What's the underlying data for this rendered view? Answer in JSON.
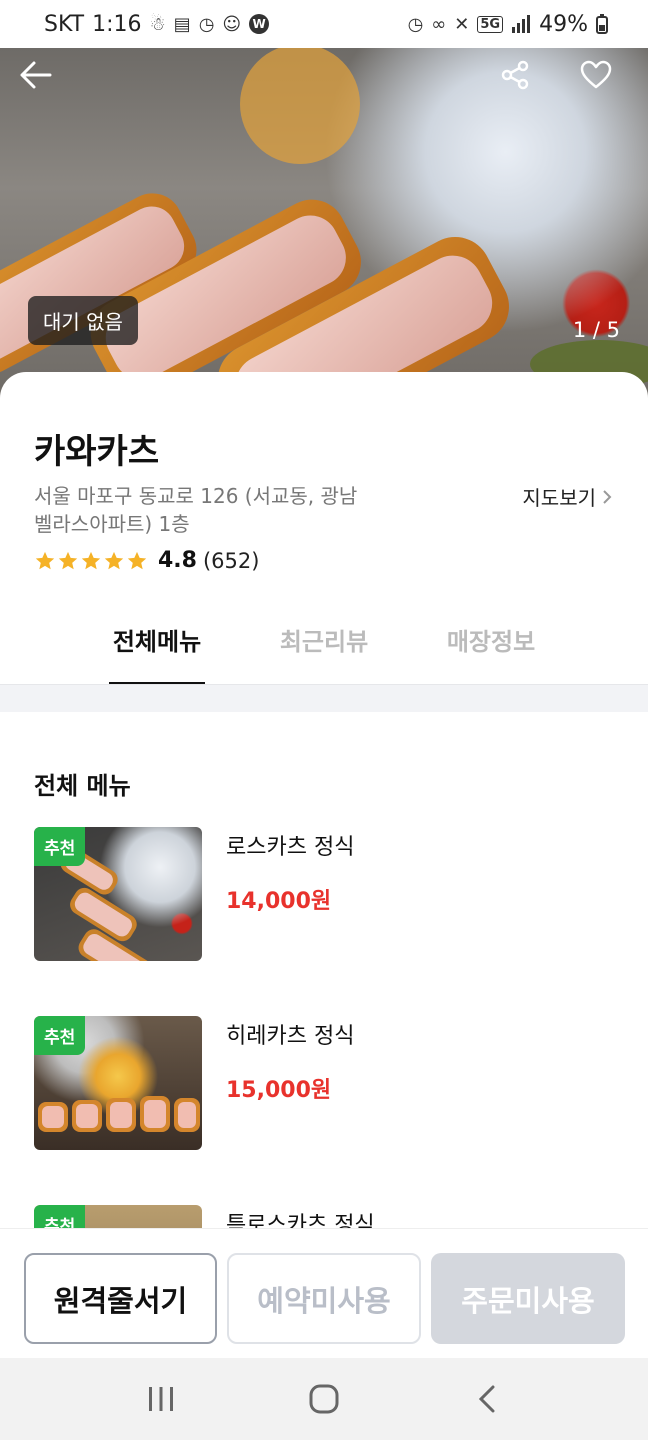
{
  "status": {
    "carrier": "SKT",
    "time": "1:16",
    "network": "5G",
    "battery": "49%",
    "w_badge": "W"
  },
  "hero": {
    "waiting_badge": "대기 없음",
    "image_counter": "1 / 5"
  },
  "store": {
    "name": "카와카츠",
    "address": "서울 마포구 동교로 126 (서교동, 광남벨라스아파트) 1층",
    "map_link": "지도보기",
    "rating": "4.8",
    "review_count": "(652)",
    "rating_stars": 5
  },
  "tabs": [
    {
      "label": "전체메뉴",
      "active": true
    },
    {
      "label": "최근리뷰",
      "active": false
    },
    {
      "label": "매장정보",
      "active": false
    }
  ],
  "menu": {
    "section_title": "전체 메뉴",
    "items": [
      {
        "badge": "추천",
        "name": "로스카츠 정식",
        "price": "14,000원"
      },
      {
        "badge": "추천",
        "name": "히레카츠 정식",
        "price": "15,000원"
      },
      {
        "badge": "추천",
        "name": "특로스카츠 정식",
        "price": ""
      }
    ]
  },
  "actions": {
    "remote_queue": "원격줄서기",
    "reservation": "예약미사용",
    "order": "주문미사용"
  },
  "colors": {
    "recommend_green": "#27b24a",
    "price_red": "#e8322c",
    "star_yellow": "#f5b227"
  }
}
